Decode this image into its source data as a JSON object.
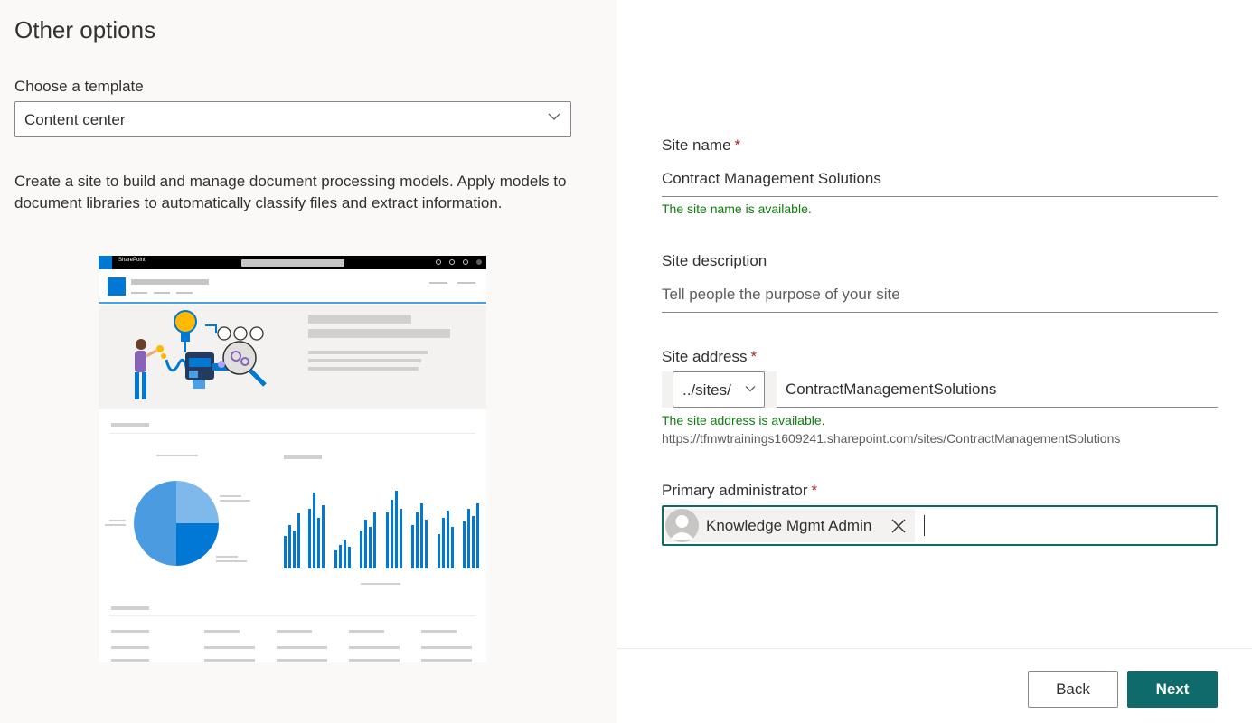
{
  "colors": {
    "accent": "#0f6b6b",
    "success": "#107c10",
    "required": "#a4262c",
    "brand_blue": "#0078d4"
  },
  "left": {
    "title": "Other options",
    "template_label": "Choose a template",
    "template_value": "Content center",
    "description": "Create a site to build and manage document processing models. Apply models to document libraries to automatically classify files and extract information.",
    "preview": {
      "brand": "SharePoint"
    }
  },
  "form": {
    "required_marker": "*",
    "site_name": {
      "label": "Site name",
      "value": "Contract Management Solutions",
      "status": "The site name is available."
    },
    "site_description": {
      "label": "Site description",
      "placeholder": "Tell people the purpose of your site"
    },
    "site_address": {
      "label": "Site address",
      "prefix": "../sites/",
      "value": "ContractManagementSolutions",
      "status": "The site address is available.",
      "full_url": "https://tfmwtrainings1609241.sharepoint.com/sites/ContractManagementSolutions"
    },
    "primary_admin": {
      "label": "Primary administrator",
      "persona_name": "Knowledge Mgmt Admin",
      "remove_icon": "close-icon"
    }
  },
  "footer": {
    "back_label": "Back",
    "next_label": "Next"
  }
}
